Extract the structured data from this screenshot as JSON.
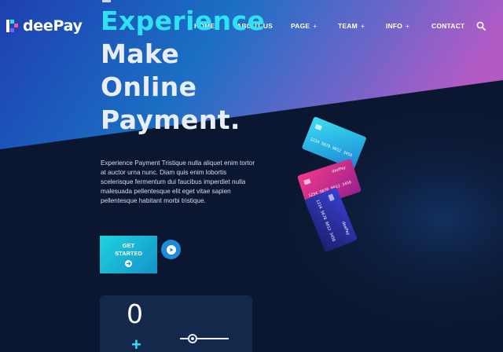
{
  "brand": {
    "name": "deePay"
  },
  "nav": {
    "items": [
      {
        "label": "HOME",
        "has_submenu": false
      },
      {
        "label": "ABOUT US",
        "has_submenu": false
      },
      {
        "label": "PAGE",
        "has_submenu": true
      },
      {
        "label": "TEAM",
        "has_submenu": true
      },
      {
        "label": "INFO",
        "has_submenu": true
      },
      {
        "label": "CONTACT",
        "has_submenu": false
      }
    ],
    "submenu_marker": "+",
    "search_icon": "search-icon"
  },
  "hero": {
    "headline_line1": "Experience",
    "headline_line2": "Make",
    "headline_line3": "Online",
    "headline_line4": "Payment.",
    "description": "Experience Payment Tristique nulla aliquet enim tortor at auctor urna nunc. Diam quis enim lobortis scelerisque fermentum dui faucibus imperdiet nulla malesuada pellentesque elit eget vitae sapien pellentesque habitant morbi tristique.",
    "cta_line1": "GET",
    "cta_line2": "STARTED",
    "cta_icon": "arrow-right-circle-icon",
    "play_icon": "play-icon"
  },
  "widget": {
    "counter_value": "0",
    "plus_label": "+",
    "slider_value": 0.2
  },
  "cards": {
    "card_brand": "deePay",
    "card_number": "1234 5678 9012 3456",
    "colors": [
      "#2ec8ee",
      "#d3257c",
      "#2a2fa0"
    ]
  },
  "colors": {
    "accent_cyan": "#2ee1f4",
    "background": "#0b1730",
    "gradient_start": "#1f3fb0",
    "gradient_end": "#b25bc6"
  }
}
